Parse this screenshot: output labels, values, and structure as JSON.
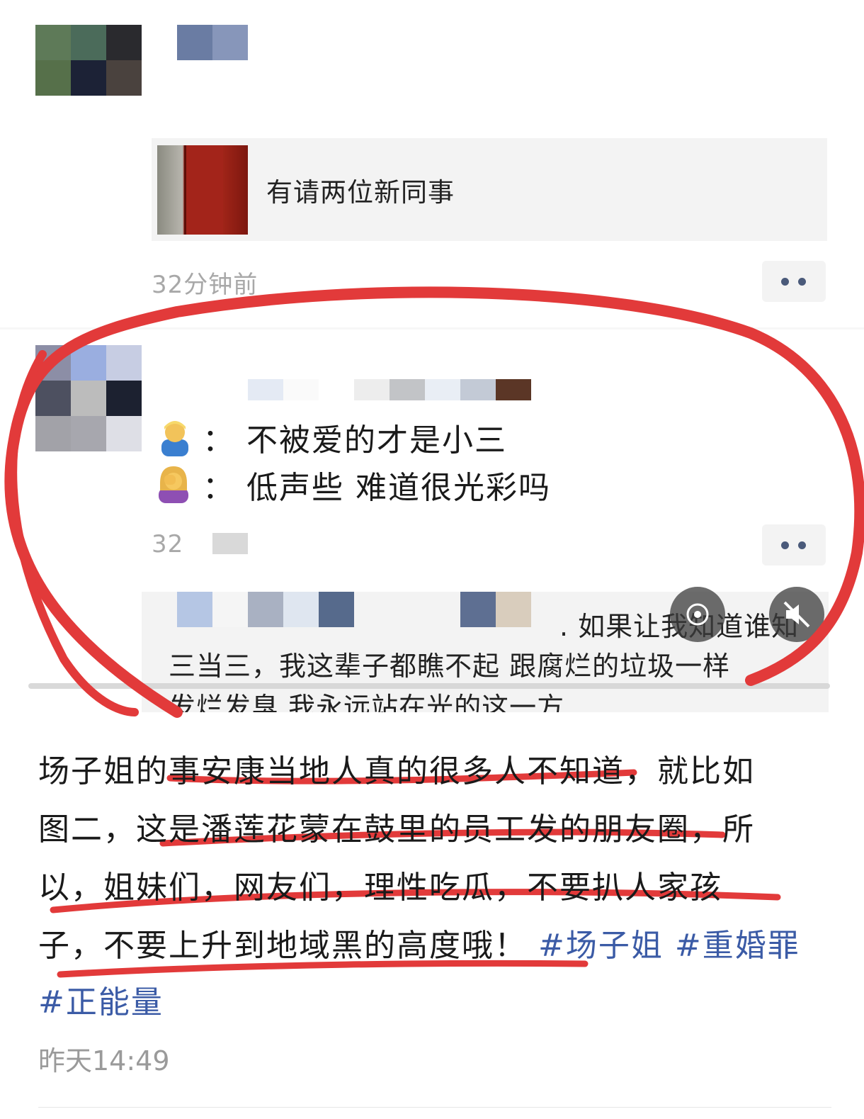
{
  "screenshot": {
    "shared_link": {
      "title": "有请两位新同事"
    },
    "first_post_time": "32分钟前",
    "second_post": {
      "line1_text": "：  不被爱的才是小三",
      "line2_text": "：  低声些 难道很光彩吗",
      "time_partial": "32",
      "line1_emoji": "man-emoji",
      "line2_emoji": "woman-facepalm-emoji"
    },
    "reply": {
      "line1": ". 如果让我知道谁知",
      "line2": "三当三，我这辈子都瞧不起 跟腐烂的垃圾一样",
      "line3": "发烂发臭  我永远站在光的这一方"
    },
    "colors": {
      "annotation_red": "#e23a3a",
      "link_blue": "#3b5ba6"
    }
  },
  "caption": {
    "line1": "场子姐的事安康当地人真的很多人不知道，就比如",
    "line2": "图二，这是潘莲花蒙在鼓里的员工发的朋友圈，所",
    "line3": "以，姐妹们，网友们，理性吃瓜，不要扒人家孩",
    "line4_text": "子，不要上升到地域黑的高度哦！",
    "tags": [
      "#场子姐",
      "#重婚罪",
      "#正能量"
    ]
  },
  "meta": {
    "time": "昨天14:49"
  }
}
